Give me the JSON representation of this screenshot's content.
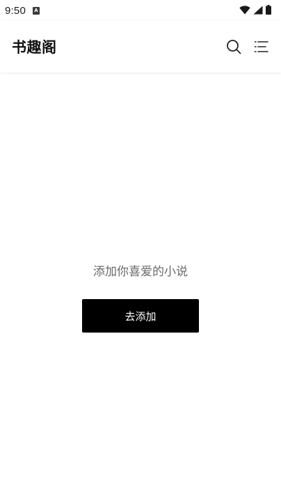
{
  "status_bar": {
    "time": "9:50",
    "notification_icon": "a-badge-icon",
    "icons": [
      "wifi-icon",
      "signal-icon",
      "battery-icon"
    ]
  },
  "app_bar": {
    "title": "书趣阁",
    "actions": [
      "search-icon",
      "menu-icon"
    ]
  },
  "empty_state": {
    "message": "添加你喜爱的小说",
    "button_label": "去添加"
  },
  "colors": {
    "background": "#ffffff",
    "button_bg": "#000000",
    "button_text": "#ffffff",
    "empty_text": "#6b6b6b"
  }
}
